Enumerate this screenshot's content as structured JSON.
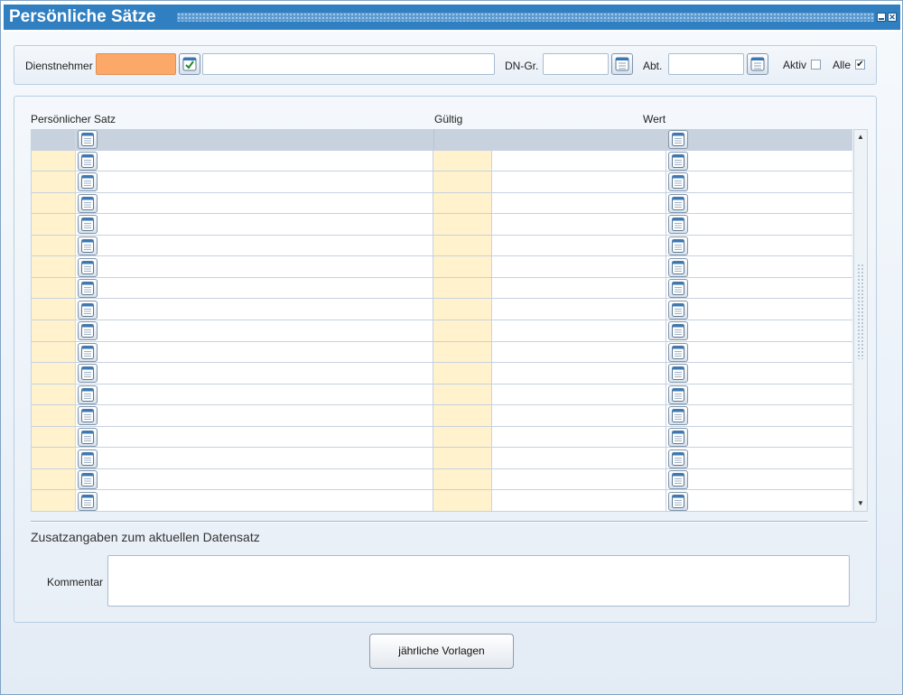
{
  "window": {
    "title": "Persönliche Sätze",
    "accent_color": "#2f7fc1",
    "controls": [
      "minimize-icon",
      "close-icon"
    ]
  },
  "filter": {
    "employee_label": "Dienstnehmer",
    "employee_value": "",
    "employee_name_value": "",
    "dn_group_label": "DN-Gr.",
    "dn_group_value": "",
    "department_label": "Abt.",
    "department_value": "",
    "active_label": "Aktiv",
    "active_checked": false,
    "all_label": "Alle",
    "all_checked": true
  },
  "grid": {
    "columns": [
      "Persönlicher Satz",
      "Gültig",
      "Wert"
    ],
    "row_count": 17,
    "rows": []
  },
  "details": {
    "section_title": "Zusatzangaben zum aktuellen Datensatz",
    "comment_label": "Kommentar",
    "comment_value": ""
  },
  "actions": {
    "annual_templates_label": "jährliche Vorlagen"
  }
}
